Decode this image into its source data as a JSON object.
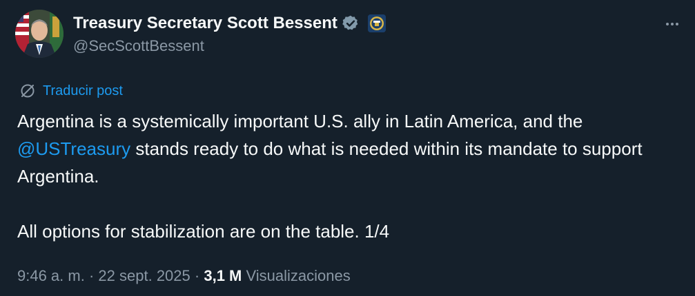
{
  "author": {
    "display_name": "Treasury Secretary Scott Bessent",
    "handle": "@SecScottBessent"
  },
  "translate_label": "Traducir post",
  "post": {
    "line1_text": "Argentina is a systemically important U.S. ally in Latin America, and the",
    "mention": "@USTreasury",
    "line2_rest": " stands ready to do what is needed within its mandate to support Argentina.",
    "paragraph2": "All options for stabilization are on the table. 1/4"
  },
  "meta": {
    "time": "9:46 a. m.",
    "separator": "·",
    "date": "22 sept. 2025",
    "views_count": "3,1 M",
    "views_label": "Visualizaciones"
  },
  "colors": {
    "background": "#15202b",
    "text": "#f7f9f9",
    "secondary": "#8b98a5",
    "accent": "#1d9bf0"
  },
  "icons": {
    "verified": "verified-badge-icon",
    "affiliate": "treasury-seal-icon",
    "more": "more-dots-icon",
    "translate": "translate-globe-icon"
  }
}
